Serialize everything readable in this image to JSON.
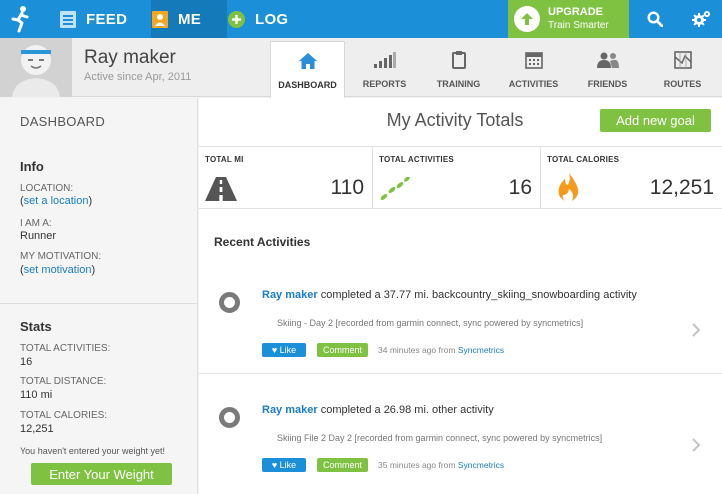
{
  "nav": {
    "feed": "FEED",
    "me": "ME",
    "log": "LOG",
    "upgrade_title": "UPGRADE",
    "upgrade_sub": "Train Smarter"
  },
  "profile": {
    "name": "Ray maker",
    "since": "Active since Apr, 2011"
  },
  "tabs": [
    {
      "label": "DASHBOARD",
      "icon": "home-icon"
    },
    {
      "label": "REPORTS",
      "icon": "bar-chart-icon"
    },
    {
      "label": "TRAINING",
      "icon": "clipboard-icon"
    },
    {
      "label": "ACTIVITIES",
      "icon": "calendar-icon"
    },
    {
      "label": "FRIENDS",
      "icon": "friends-icon"
    },
    {
      "label": "ROUTES",
      "icon": "map-icon"
    }
  ],
  "sidebar": {
    "title": "DASHBOARD",
    "info_heading": "Info",
    "location_label": "LOCATION:",
    "location_link": "set a location",
    "iama_label": "I AM A:",
    "iama_value": "Runner",
    "motivation_label": "MY MOTIVATION:",
    "motivation_link": "set motivation",
    "stats_heading": "Stats",
    "total_activities_label": "TOTAL ACTIVITIES:",
    "total_activities_value": "16",
    "total_distance_label": "TOTAL DISTANCE:",
    "total_distance_value": "110 mi",
    "total_calories_label": "TOTAL CALORIES:",
    "total_calories_value": "12,251",
    "weight_note": "You haven't entered your weight yet!",
    "weight_button": "Enter Your Weight"
  },
  "main": {
    "title": "My Activity Totals",
    "goal_button": "Add new goal",
    "totals": [
      {
        "label": "TOTAL MI",
        "value": "110"
      },
      {
        "label": "TOTAL ACTIVITIES",
        "value": "16"
      },
      {
        "label": "TOTAL CALORIES",
        "value": "12,251"
      }
    ],
    "recent_heading": "Recent Activities",
    "activities": [
      {
        "who": "Ray maker",
        "text": " completed a 37.77 mi. backcountry_skiing_snowboarding activity",
        "detail": "Skiing - Day 2 [recorded from garmin connect, sync powered by syncmetrics]",
        "like": "Like",
        "comment": "Comment",
        "time": "34 minutes ago from ",
        "source": "Syncmetrics"
      },
      {
        "who": "Ray maker",
        "text": " completed a 26.98 mi. other activity",
        "detail": "Skiing File 2 Day 2 [recorded from garmin connect, sync powered by syncmetrics]",
        "like": "Like",
        "comment": "Comment",
        "time": "35 minutes ago from ",
        "source": "Syncmetrics"
      }
    ]
  },
  "colors": {
    "nav_blue": "#1b8fd8",
    "accent_green": "#7fc241",
    "link_blue": "#1b7dc4",
    "fire_orange": "#f59a1b"
  }
}
